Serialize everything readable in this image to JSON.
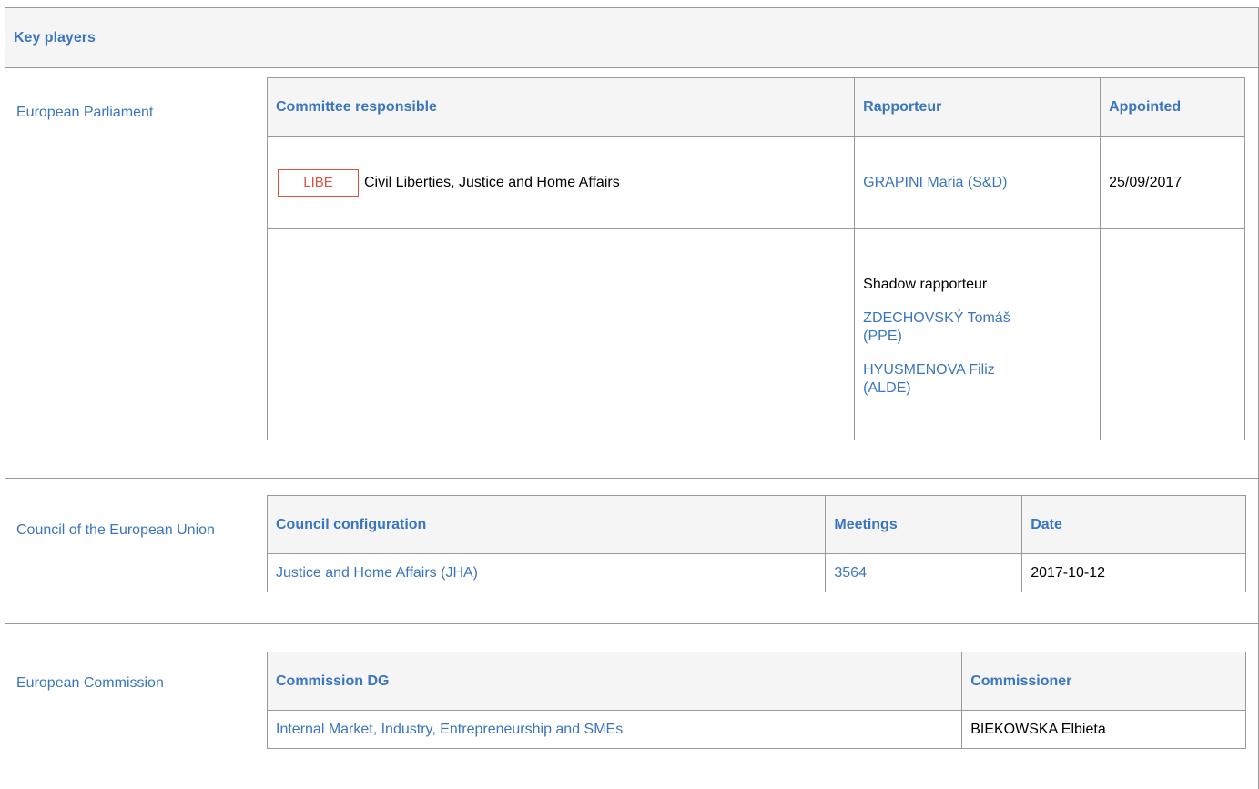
{
  "header": {
    "title": "Key players"
  },
  "ep": {
    "label": "European Parliament",
    "headers": {
      "committee": "Committee responsible",
      "rapporteur": "Rapporteur",
      "appointed": "Appointed"
    },
    "committee_badge": "LIBE",
    "committee_name": "Civil Liberties, Justice and Home Affairs",
    "rapporteur": "GRAPINI Maria (S&D)",
    "appointed": "25/09/2017",
    "shadow_label": "Shadow rapporteur",
    "shadows": [
      "ZDECHOVSKÝ Tomáš (PPE)",
      "HYUSMENOVA Filiz (ALDE)"
    ]
  },
  "council": {
    "label": "Council of the European Union",
    "headers": {
      "configuration": "Council configuration",
      "meetings": "Meetings",
      "date": "Date"
    },
    "configuration": "Justice and Home Affairs (JHA)",
    "meetings": "3564",
    "date": "2017-10-12"
  },
  "commission": {
    "label": "European Commission",
    "headers": {
      "dg": "Commission DG",
      "commissioner": "Commissioner"
    },
    "dg": "Internal Market, Industry, Entrepreneurship and SMEs",
    "commissioner": "BIEKOWSKA Elbieta"
  }
}
